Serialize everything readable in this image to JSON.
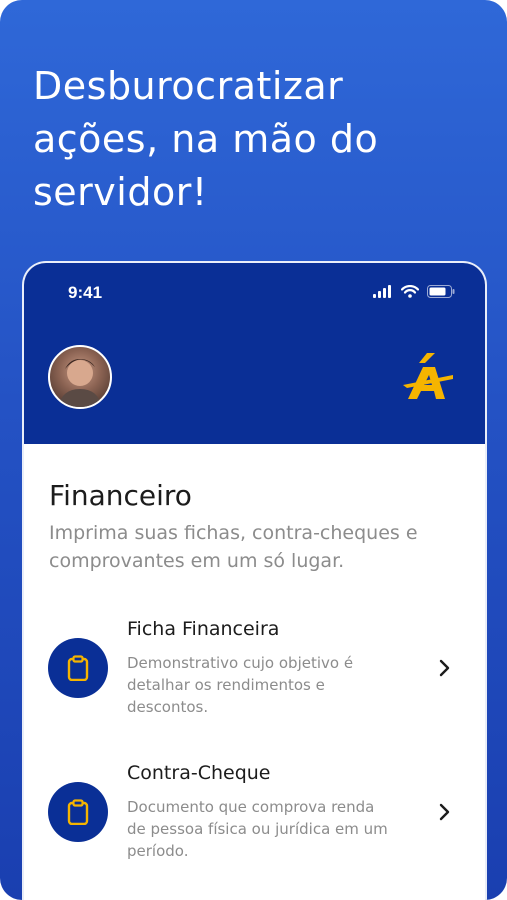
{
  "headline": "Desburocratizar ações, na mão do servidor!",
  "status_bar": {
    "time": "9:41"
  },
  "colors": {
    "brand_blue": "#0a2f96",
    "accent_yellow": "#f5b400",
    "background_blue": "#2452c4"
  },
  "section": {
    "title": "Financeiro",
    "subtitle": "Imprima suas fichas, contra-cheques e comprovantes em um só lugar."
  },
  "items": [
    {
      "title": "Ficha Financeira",
      "description": "Demonstrativo cujo objetivo é detalhar os rendimentos e descontos.",
      "icon": "clipboard-icon"
    },
    {
      "title": "Contra-Cheque",
      "description": "Documento que comprova renda de pessoa física ou jurídica em um período.",
      "icon": "clipboard-icon"
    }
  ]
}
